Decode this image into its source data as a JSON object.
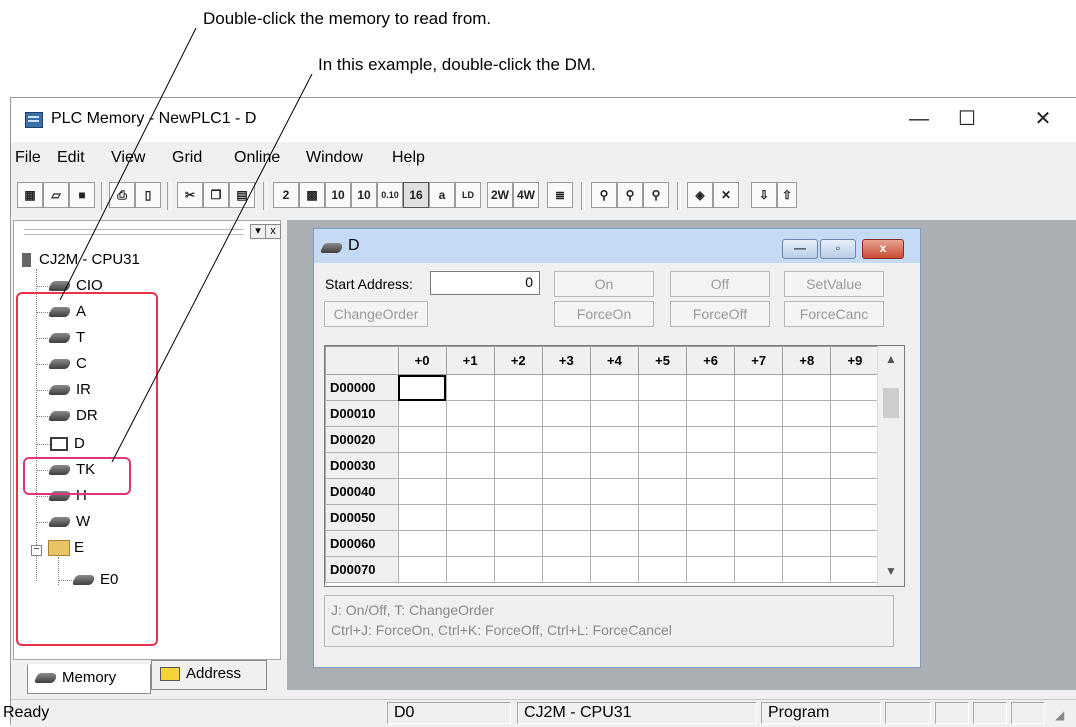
{
  "callouts": {
    "memory_hint": "Double-click the memory to read from.",
    "dm_hint": "In this example, double-click the DM."
  },
  "window": {
    "title": "PLC Memory - NewPLC1 - D",
    "minimize": "—",
    "maximize": "☐",
    "close": "✕"
  },
  "menu": {
    "file": "File",
    "edit": "Edit",
    "view": "View",
    "grid": "Grid",
    "online": "Online",
    "window": "Window",
    "help": "Help"
  },
  "toolbar": {
    "btn_2": "2",
    "btn_10": "10",
    "btn_10u": "10",
    "btn_0_10": "0.10",
    "btn_16": "16",
    "btn_a": "a",
    "btn_2w": "2W",
    "btn_4w": "4W"
  },
  "tree": {
    "pane_pin": "▾",
    "pane_close": "x",
    "root": "CJ2M - CPU31",
    "items": [
      "CIO",
      "A",
      "T",
      "C",
      "IR",
      "DR",
      "D",
      "TK",
      "H",
      "W"
    ],
    "folder": "E",
    "folder_expander": "−",
    "sub_item": "E0"
  },
  "tabs": {
    "memory": "Memory",
    "address": "Address"
  },
  "child": {
    "title": "D",
    "btn_min": "—",
    "btn_max": "▫",
    "btn_close": "x",
    "start_address_label": "Start Address:",
    "start_address_value": "0",
    "buttons": {
      "on": "On",
      "off": "Off",
      "setvalue": "SetValue",
      "changeorder": "ChangeOrder",
      "forceon": "ForceOn",
      "forceoff": "ForceOff",
      "forcecanc": "ForceCanc"
    },
    "columns": [
      "+0",
      "+1",
      "+2",
      "+3",
      "+4",
      "+5",
      "+6",
      "+7",
      "+8",
      "+9"
    ],
    "rows": [
      "D00000",
      "D00010",
      "D00020",
      "D00030",
      "D00040",
      "D00050",
      "D00060",
      "D00070"
    ],
    "scroll_up": "▲",
    "scroll_down": "▼",
    "hint_line1": "J: On/Off,   T: ChangeOrder",
    "hint_line2": "Ctrl+J: ForceOn,   Ctrl+K: ForceOff,   Ctrl+L: ForceCancel"
  },
  "status": {
    "ready": "Ready",
    "address": "D0",
    "device": "CJ2M - CPU31",
    "mode": "Program"
  }
}
